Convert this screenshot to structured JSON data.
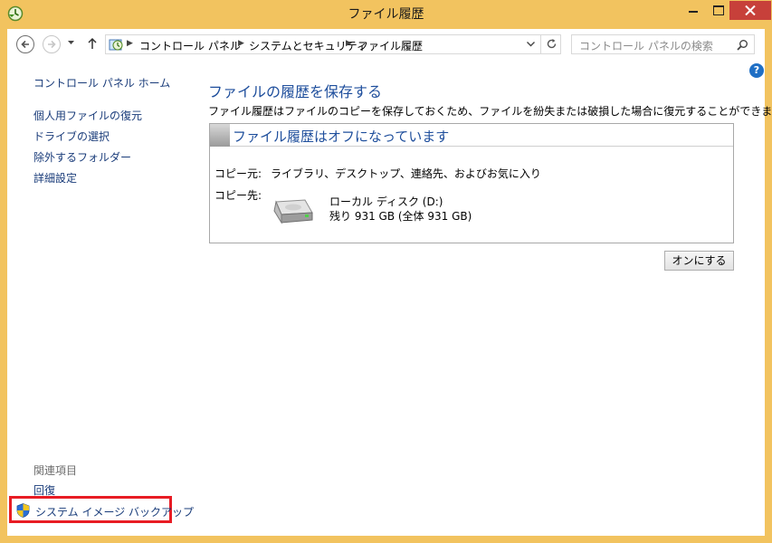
{
  "window": {
    "title": "ファイル履歴"
  },
  "address_bar": {
    "crumbs": [
      "コントロール パネル",
      "システムとセキュリティ",
      "ファイル履歴"
    ]
  },
  "search": {
    "placeholder": "コントロール パネルの検索"
  },
  "help": {
    "label": "?"
  },
  "left_pane": {
    "home": "コントロール パネル ホーム",
    "links": [
      "個人用ファイルの復元",
      "ドライブの選択",
      "除外するフォルダー",
      "詳細設定"
    ],
    "related_title": "関連項目",
    "related": [
      "回復",
      "システム イメージ バックアップ"
    ]
  },
  "main": {
    "title": "ファイルの履歴を保存する",
    "description": "ファイル履歴はファイルのコピーを保存しておくため、ファイルを紛失または破損した場合に復元することができます。",
    "status": "ファイル履歴はオフになっています",
    "copy_from_label": "コピー元:",
    "copy_from_value": "ライブラリ、デスクトップ、連絡先、およびお気に入り",
    "copy_to_label": "コピー先:",
    "drive_name": "ローカル ディスク (D:)",
    "drive_space": "残り 931 GB (全体 931 GB)",
    "turn_on_button": "オンにする"
  },
  "colors": {
    "frame": "#f2c35f",
    "link": "#1a3c7a",
    "heading": "#1e4e9c",
    "close_button": "#c7403a",
    "highlight": "#e81c24"
  }
}
